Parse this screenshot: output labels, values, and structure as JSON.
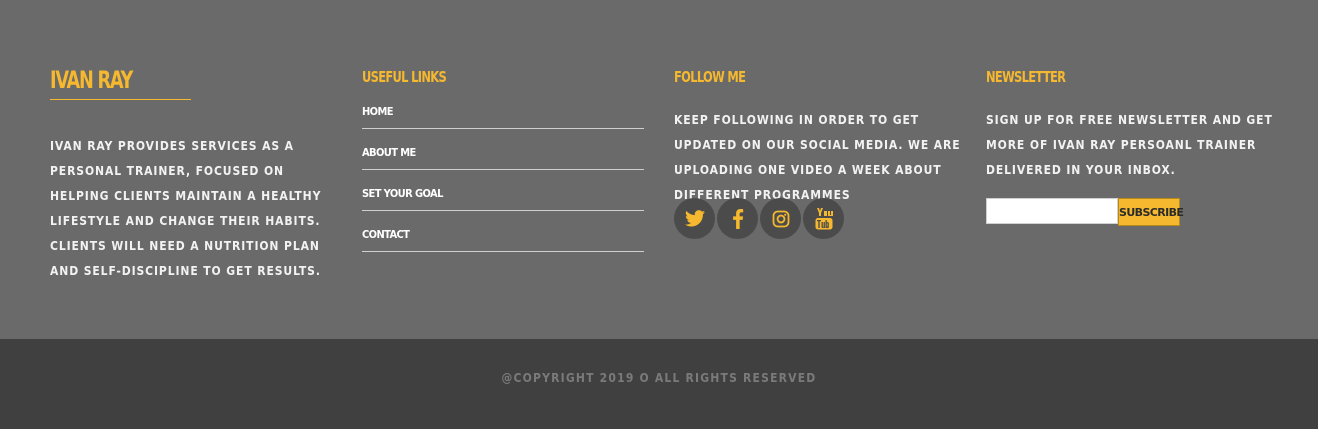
{
  "colors": {
    "accent": "#f5b82e",
    "footer_bg": "#6a6a6a",
    "bottom_bg": "#404040",
    "social_bg": "#4b4b4b"
  },
  "about": {
    "brand": "IVAN RAY",
    "text": "IVAN RAY PROVIDES SERVICES AS A PERSONAL TRAINER, FOCUSED ON HELPING CLIENTS MAINTAIN A HEALTHY LIFESTYLE AND CHANGE THEIR HABITS. CLIENTS WILL NEED A NUTRITION PLAN AND SELF-DISCIPLINE TO GET RESULTS."
  },
  "links": {
    "heading": "USEFUL LINKS",
    "items": [
      {
        "label": "HOME"
      },
      {
        "label": "ABOUT ME"
      },
      {
        "label": "SET YOUR GOAL"
      },
      {
        "label": "CONTACT"
      }
    ]
  },
  "follow": {
    "heading": "FOLLOW ME",
    "text": "KEEP FOLLOWING IN ORDER TO GET UPDATED ON OUR SOCIAL MEDIA. WE ARE UPLOADING ONE VIDEO A WEEK ABOUT DIFFERENT PROGRAMMES",
    "icons": [
      "twitter-icon",
      "facebook-icon",
      "instagram-icon",
      "youtube-icon"
    ]
  },
  "newsletter": {
    "heading": "NEWSLETTER",
    "text": "SIGN UP FOR FREE NEWSLETTER AND GET MORE OF IVAN RAY PERSOANL TRAINER DELIVERED IN YOUR INBOX.",
    "input_value": "",
    "button_label": "SUBSCRIBE"
  },
  "footer": {
    "copyright": "@COPYRIGHT 2019 O ALL RIGHTS RESERVED"
  }
}
